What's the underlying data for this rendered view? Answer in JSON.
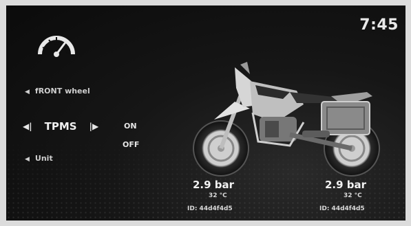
{
  "clock": "7:45",
  "menu": {
    "front_wheel": "fRONT wheel",
    "tpms": "TPMS",
    "on": "ON",
    "off": "OFF",
    "unit": "Unit"
  },
  "tires": {
    "front": {
      "pressure": "2.9 bar",
      "temp": "32 °C",
      "id": "ID: 44d4f4d5"
    },
    "rear": {
      "pressure": "2.9 bar",
      "temp": "32 °C",
      "id": "ID: 44d4f4d5"
    }
  },
  "icons": {
    "gauge": "speedometer-icon",
    "left": "triangle-left-icon",
    "prev": "skip-back-icon",
    "next": "skip-forward-icon"
  }
}
